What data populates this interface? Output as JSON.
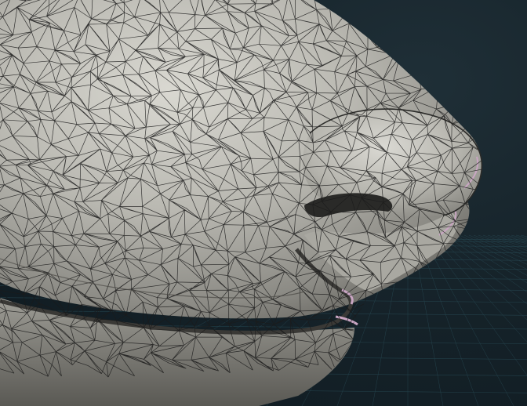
{
  "viewport": {
    "background_color": "#16232a",
    "grid_color": "#2f5a66",
    "mesh_surface_color": "#bdbcb5",
    "mesh_shadow_color": "#5e5d58",
    "wireframe_color": "#1b1b1b",
    "accent_color": "#c9a6c3",
    "render_mode": "shaded-wireframe"
  }
}
